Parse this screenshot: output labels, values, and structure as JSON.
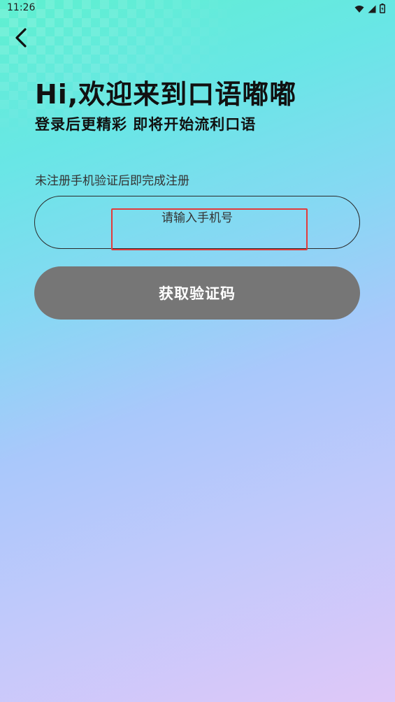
{
  "status_bar": {
    "time": "11:26",
    "icons": [
      "wifi-icon",
      "signal-icon",
      "battery-icon"
    ]
  },
  "header": {
    "back_icon": "chevron-left-icon",
    "title": "Hi,欢迎来到口语嘟嘟",
    "subtitle": "登录后更精彩 即将开始流利口语"
  },
  "form": {
    "hint": "未注册手机验证后即完成注册",
    "phone_input": {
      "value": "",
      "placeholder": "请输入手机号"
    },
    "get_code_label": "获取验证码"
  },
  "colors": {
    "button_bg": "#767676",
    "highlight_border": "#e23b3b",
    "text_primary": "#111111"
  }
}
